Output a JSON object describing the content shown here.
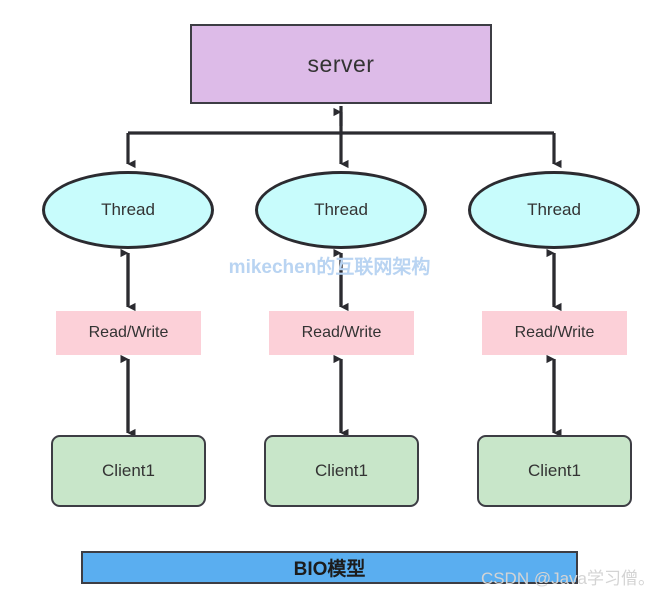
{
  "diagram": {
    "title": "BIO模型",
    "server": {
      "label": "server"
    },
    "columns": [
      {
        "thread": "Thread",
        "io": "Read/Write",
        "client": "Client1"
      },
      {
        "thread": "Thread",
        "io": "Read/Write",
        "client": "Client1"
      },
      {
        "thread": "Thread",
        "io": "Read/Write",
        "client": "Client1"
      }
    ],
    "watermarks": {
      "center": "mikechen的互联网架构",
      "corner": "CSDN @Java学习僧。"
    },
    "colors": {
      "server_fill": "#ddbbe8",
      "thread_fill": "#c8fcfc",
      "readwrite_fill": "#fcd0d8",
      "client_fill": "#c8e6c9",
      "banner_fill": "#5aaef0",
      "stroke": "#3d3d44",
      "watermark_center": "#b9d4f2",
      "watermark_corner": "#d4d4d4"
    }
  }
}
